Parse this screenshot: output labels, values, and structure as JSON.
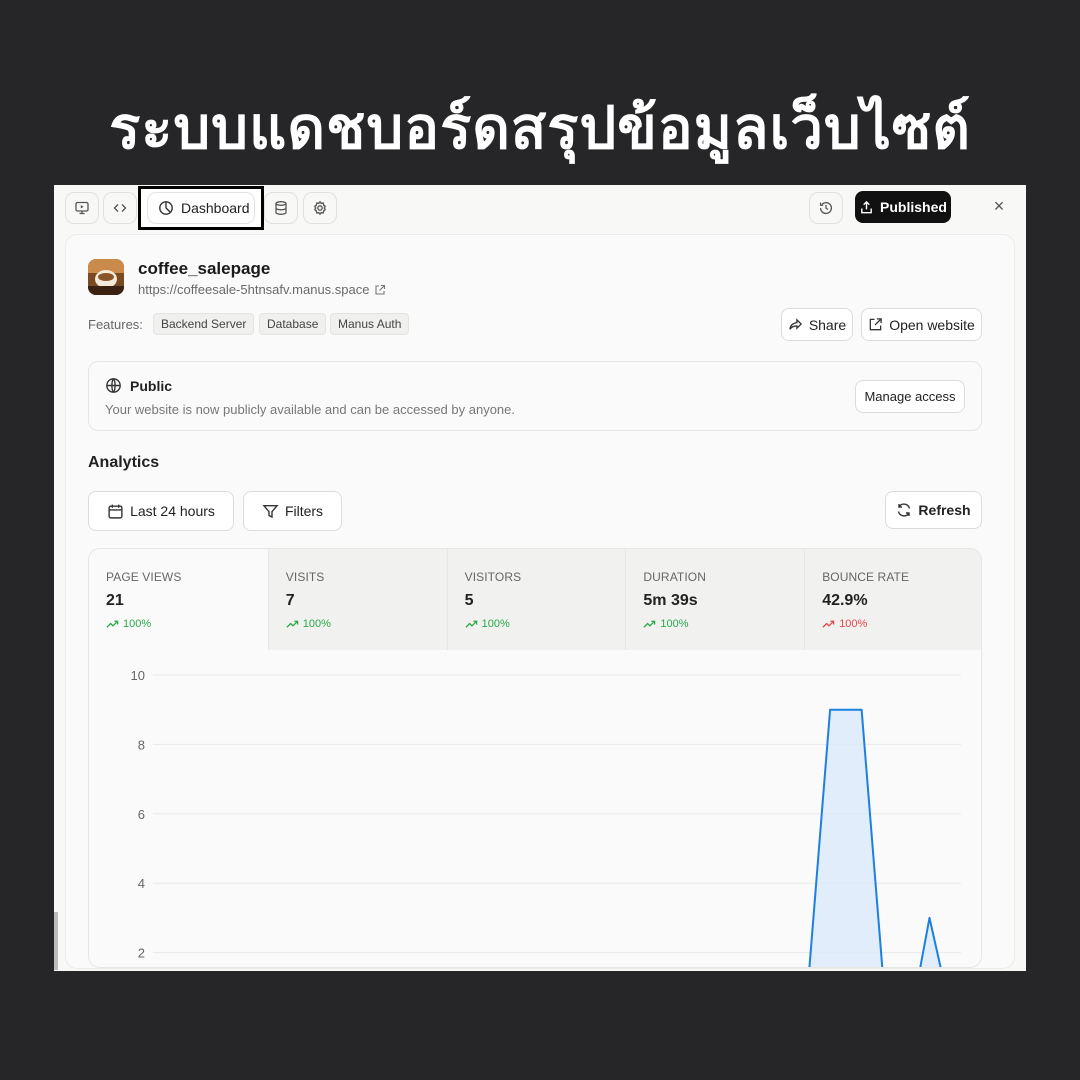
{
  "headline": "ระบบแดชบอร์ดสรุปข้อมูลเว็บไซต์",
  "toolbar": {
    "dashboard_tab": "Dashboard",
    "published_label": "Published",
    "close_label": "×"
  },
  "app": {
    "name": "coffee_salepage",
    "url": "https://coffeesale-5htnsafv.manus.space"
  },
  "features": {
    "label": "Features:",
    "items": [
      "Backend Server",
      "Database",
      "Manus Auth"
    ]
  },
  "actions": {
    "share": "Share",
    "open_website": "Open website"
  },
  "visibility": {
    "title": "Public",
    "description": "Your website is now publicly available and can be accessed by anyone.",
    "manage_access": "Manage access"
  },
  "analytics": {
    "title": "Analytics",
    "time_range": "Last 24 hours",
    "filters": "Filters",
    "refresh": "Refresh"
  },
  "stats": [
    {
      "label": "PAGE VIEWS",
      "value": "21",
      "change": "100%",
      "trend": "up"
    },
    {
      "label": "VISITS",
      "value": "7",
      "change": "100%",
      "trend": "up"
    },
    {
      "label": "VISITORS",
      "value": "5",
      "change": "100%",
      "trend": "up"
    },
    {
      "label": "DURATION",
      "value": "5m 39s",
      "change": "100%",
      "trend": "up"
    },
    {
      "label": "BOUNCE RATE",
      "value": "42.9%",
      "change": "100%",
      "trend": "down"
    }
  ],
  "colors": {
    "up": "#2aa84a",
    "down": "#e5484d",
    "line": "#1d7fe0",
    "fill": "#d8e8f9"
  },
  "chart_data": {
    "type": "area",
    "y_ticks": [
      "10",
      "8",
      "6",
      "4",
      "2"
    ],
    "ylim": [
      0,
      10
    ],
    "grid": true,
    "points": [
      {
        "x": 0.0,
        "y": 0
      },
      {
        "x": 0.807,
        "y": 0
      },
      {
        "x": 0.838,
        "y": 9
      },
      {
        "x": 0.877,
        "y": 9
      },
      {
        "x": 0.908,
        "y": 0
      },
      {
        "x": 0.937,
        "y": 0
      },
      {
        "x": 0.961,
        "y": 3
      },
      {
        "x": 0.99,
        "y": 0
      }
    ]
  }
}
